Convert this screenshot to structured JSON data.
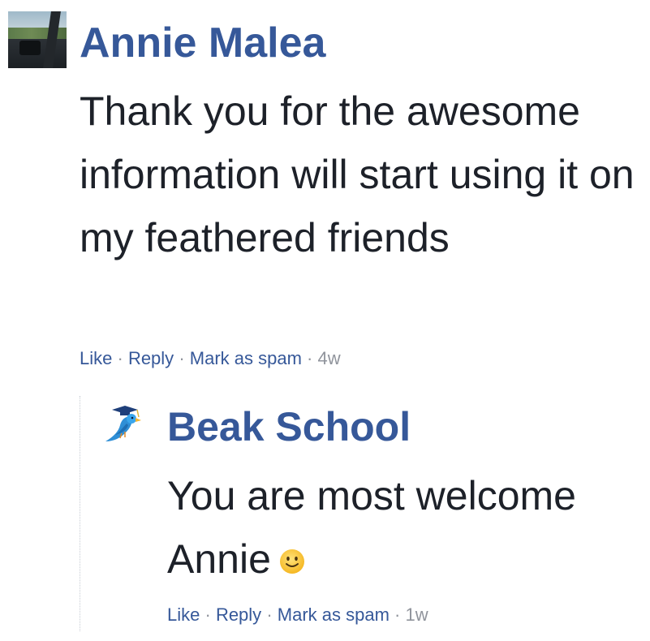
{
  "comment": {
    "author": "Annie Malea",
    "text": "Thank you for the awesome information will start using it on my feathered friends",
    "actions": {
      "like": "Like",
      "reply": "Reply",
      "spam": "Mark as spam",
      "separator": "·",
      "time": "4w"
    }
  },
  "reply": {
    "author": "Beak School",
    "text": "You are most welcome Annie",
    "emoji_icon": "slightly-smiling-face",
    "actions": {
      "like": "Like",
      "reply": "Reply",
      "spam": "Mark as spam",
      "separator": "·",
      "time": "1w"
    }
  },
  "colors": {
    "link": "#365899",
    "text": "#1d2129",
    "meta": "#90949c"
  }
}
